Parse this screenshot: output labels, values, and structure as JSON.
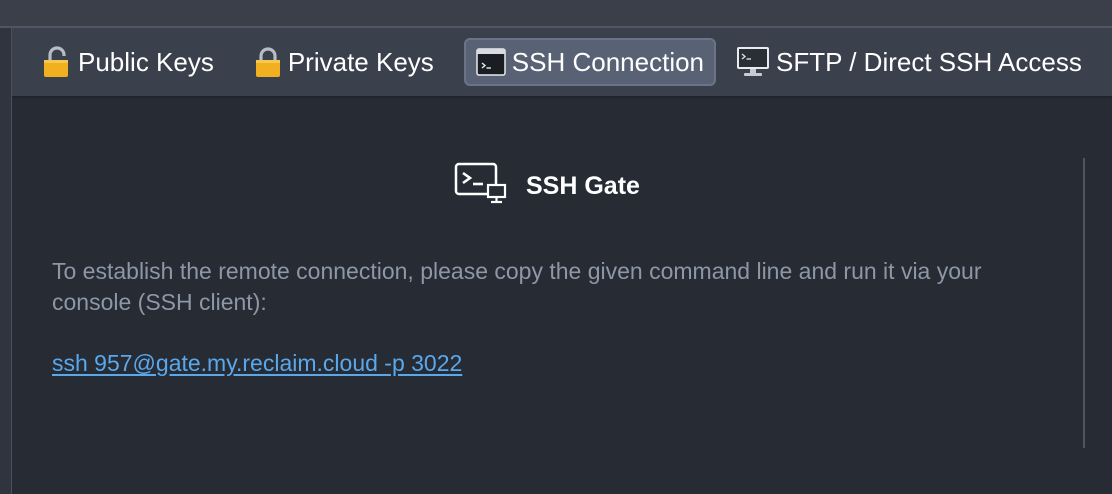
{
  "tabs": [
    {
      "label": "Public Keys",
      "icon": "lock-open-icon",
      "active": false
    },
    {
      "label": "Private Keys",
      "icon": "lock-icon",
      "active": false
    },
    {
      "label": "SSH Connection",
      "icon": "terminal-icon",
      "active": true
    },
    {
      "label": "SFTP / Direct SSH Access",
      "icon": "monitor-terminal-icon",
      "active": false
    }
  ],
  "gate": {
    "title": "SSH Gate",
    "icon": "ssh-gate-icon",
    "description": "To establish the remote connection, please copy the given command line and run it via your console (SSH client):",
    "command": "ssh 957@gate.my.reclaim.cloud -p 3022"
  },
  "colors": {
    "background": "#262b34",
    "tabbar": "#3b414c",
    "active_tab": "#586274",
    "lock": "#f0b020",
    "link": "#5aa8ec",
    "text_muted": "#8d97a6"
  }
}
